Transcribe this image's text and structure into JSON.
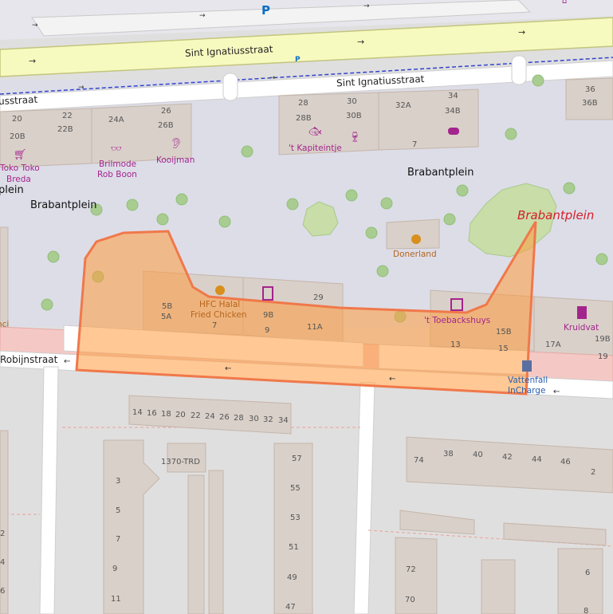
{
  "map": {
    "colors": {
      "plaza": "#dddde8",
      "road_primary": "#f7fabf",
      "road_residential": "#ffffff",
      "building": "#d9d0c9",
      "park": "#c8dda8",
      "tree": "#a9cc91",
      "poi": "#a4248d",
      "highlight_fill": "#ff9a3c",
      "highlight_stroke": "#f0784a",
      "pedestrian_pink": "#f4c9c5",
      "place_red": "#d4202a"
    },
    "streets": {
      "sint_ignatiusstraat_main": "Sint Ignatiusstraat",
      "sint_ignatiusstraat_side": "Sint Ignatiusstraat",
      "sint_ignatiusstraat_left": "usstraat",
      "robijnstraat": "Robijnstraat"
    },
    "places": {
      "brabantplein_top": "Brabantplein",
      "brabantplein_left": "Brabantplein",
      "brabantplein_edge": "plein",
      "brabantplein_park": "Brabantplein"
    },
    "parking_symbol": "P",
    "parking_small": "P",
    "pois": {
      "toko": [
        "Toko Toko",
        "Breda"
      ],
      "brilmode": [
        "Brilmode",
        "Rob Boon"
      ],
      "kooijman": "Kooijman",
      "kapiteintje": "'t Kapiteintje",
      "donerland": "Donerland",
      "hfc": [
        "HFC Halal",
        "Fried Chicken"
      ],
      "toebackshuys": "'t Toebackshuys",
      "kruidvat": "Kruidvat",
      "vattenfall": [
        "Vattenfall",
        "InCharge"
      ],
      "left_cut": "nci"
    },
    "house_numbers": {
      "top_row": [
        "20",
        "20B",
        "22",
        "22B",
        "24A",
        "26",
        "26B",
        "28",
        "28B",
        "30",
        "30B",
        "32A",
        "34",
        "34B",
        "7",
        "36",
        "36B"
      ],
      "middle_row": [
        "5B",
        "5A",
        "7",
        "9B",
        "9",
        "11A",
        "29",
        "15B",
        "13",
        "15",
        "17A",
        "19B",
        "19"
      ],
      "row_14_34": [
        "14",
        "16",
        "18",
        "20",
        "22",
        "24",
        "26",
        "28",
        "30",
        "32",
        "34"
      ],
      "building_1370": "1370-TRD",
      "left_column": [
        "3",
        "5",
        "7",
        "9",
        "11"
      ],
      "center_column": [
        "57",
        "55",
        "53",
        "51",
        "49",
        "47"
      ],
      "right_row": [
        "74",
        "38",
        "40",
        "42",
        "44",
        "46",
        "2"
      ],
      "lower_right": [
        "72",
        "70",
        "6",
        "8"
      ],
      "edge_left": [
        "2",
        "4",
        "6"
      ]
    }
  }
}
